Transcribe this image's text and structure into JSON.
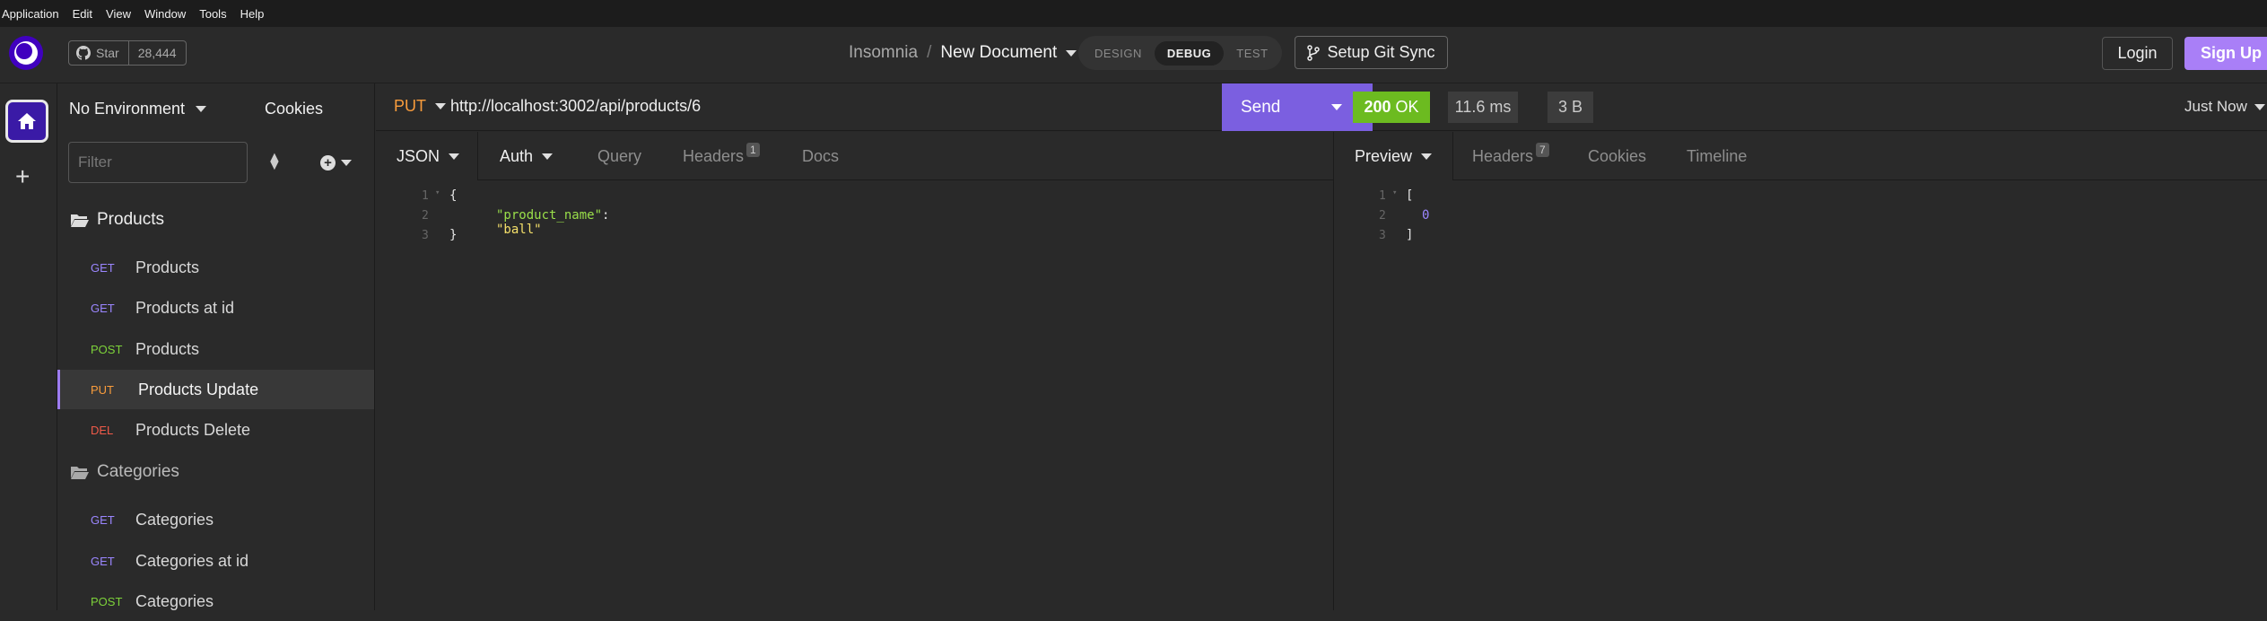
{
  "menu": [
    "Application",
    "Edit",
    "View",
    "Window",
    "Tools",
    "Help"
  ],
  "header": {
    "github": {
      "star_label": "Star",
      "count": "28,444"
    },
    "breadcrumb": {
      "project": "Insomnia",
      "separator": "/",
      "document": "New Document"
    },
    "modes": [
      "DESIGN",
      "DEBUG",
      "TEST"
    ],
    "active_mode": "DEBUG",
    "git_sync_label": "Setup Git Sync",
    "login_label": "Login",
    "signup_label": "Sign Up"
  },
  "sidebar": {
    "environment": "No Environment",
    "cookies_label": "Cookies",
    "filter_placeholder": "Filter",
    "folders": [
      {
        "name": "Products",
        "requests": [
          {
            "method": "GET",
            "name": "Products"
          },
          {
            "method": "GET",
            "name": "Products at id"
          },
          {
            "method": "POST",
            "name": "Products"
          },
          {
            "method": "PUT",
            "name": "Products Update",
            "active": true
          },
          {
            "method": "DEL",
            "name": "Products Delete"
          }
        ]
      },
      {
        "name": "Categories",
        "requests": [
          {
            "method": "GET",
            "name": "Categories"
          },
          {
            "method": "GET",
            "name": "Categories at id"
          },
          {
            "method": "POST",
            "name": "Categories"
          }
        ]
      }
    ]
  },
  "request": {
    "method": "PUT",
    "url": "http://localhost:3002/api/products/6",
    "send_label": "Send",
    "tabs": {
      "body": "JSON",
      "auth": "Auth",
      "query": "Query",
      "headers": "Headers",
      "headers_count": "1",
      "docs": "Docs"
    },
    "body_lines": [
      "1",
      "2",
      "3"
    ],
    "body": {
      "open": "{",
      "key": "\"product_name\"",
      "colon": ": ",
      "value": "\"ball\"",
      "close": "}"
    }
  },
  "response": {
    "status": {
      "code": "200",
      "text": "OK"
    },
    "time": "11.6 ms",
    "size": "3 B",
    "history_label": "Just Now",
    "tabs": {
      "preview": "Preview",
      "headers": "Headers",
      "headers_count": "7",
      "cookies": "Cookies",
      "timeline": "Timeline"
    },
    "body_lines": [
      "1",
      "2",
      "3"
    ],
    "body": {
      "open": "[",
      "value": "0",
      "close": "]"
    }
  },
  "colors": {
    "accent": "#7b5fe0",
    "ok": "#6cbb20",
    "get": "#9b86ff",
    "post": "#7dd23a",
    "put": "#f99c3c",
    "del": "#f05a49"
  }
}
